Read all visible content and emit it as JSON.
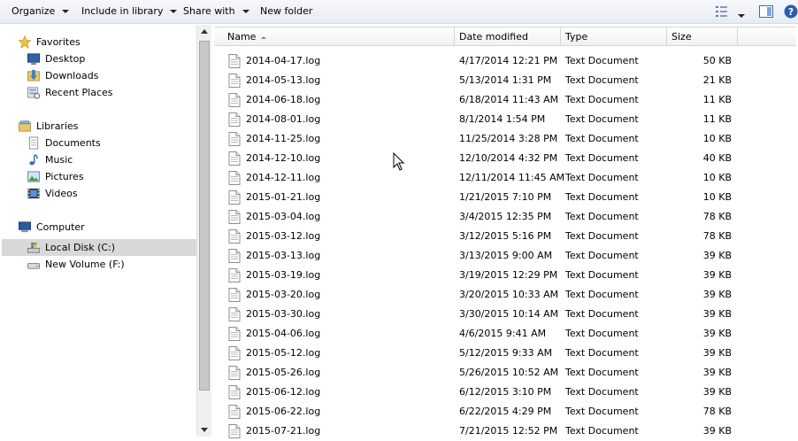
{
  "toolbar": {
    "organize": "Organize",
    "include_in_library": "Include in library",
    "share_with": "Share with",
    "new_folder": "New folder"
  },
  "nav": {
    "favorites": "Favorites",
    "desktop": "Desktop",
    "downloads": "Downloads",
    "recent_places": "Recent Places",
    "libraries": "Libraries",
    "documents": "Documents",
    "music": "Music",
    "pictures": "Pictures",
    "videos": "Videos",
    "computer": "Computer",
    "local_disk": "Local Disk (C:)",
    "new_volume": "New Volume (F:)"
  },
  "columns": {
    "name": "Name",
    "date_modified": "Date modified",
    "type": "Type",
    "size": "Size"
  },
  "files": [
    {
      "name": "2014-04-17.log",
      "date": "4/17/2014 12:21 PM",
      "type": "Text Document",
      "size": "50 KB"
    },
    {
      "name": "2014-05-13.log",
      "date": "5/13/2014 1:31 PM",
      "type": "Text Document",
      "size": "21 KB"
    },
    {
      "name": "2014-06-18.log",
      "date": "6/18/2014 11:43 AM",
      "type": "Text Document",
      "size": "11 KB"
    },
    {
      "name": "2014-08-01.log",
      "date": "8/1/2014 1:54 PM",
      "type": "Text Document",
      "size": "11 KB"
    },
    {
      "name": "2014-11-25.log",
      "date": "11/25/2014 3:28 PM",
      "type": "Text Document",
      "size": "10 KB"
    },
    {
      "name": "2014-12-10.log",
      "date": "12/10/2014 4:32 PM",
      "type": "Text Document",
      "size": "40 KB"
    },
    {
      "name": "2014-12-11.log",
      "date": "12/11/2014 11:45 AM",
      "type": "Text Document",
      "size": "10 KB"
    },
    {
      "name": "2015-01-21.log",
      "date": "1/21/2015 7:10 PM",
      "type": "Text Document",
      "size": "10 KB"
    },
    {
      "name": "2015-03-04.log",
      "date": "3/4/2015 12:35 PM",
      "type": "Text Document",
      "size": "78 KB"
    },
    {
      "name": "2015-03-12.log",
      "date": "3/12/2015 5:16 PM",
      "type": "Text Document",
      "size": "78 KB"
    },
    {
      "name": "2015-03-13.log",
      "date": "3/13/2015 9:00 AM",
      "type": "Text Document",
      "size": "39 KB"
    },
    {
      "name": "2015-03-19.log",
      "date": "3/19/2015 12:29 PM",
      "type": "Text Document",
      "size": "39 KB"
    },
    {
      "name": "2015-03-20.log",
      "date": "3/20/2015 10:33 AM",
      "type": "Text Document",
      "size": "39 KB"
    },
    {
      "name": "2015-03-30.log",
      "date": "3/30/2015 10:14 AM",
      "type": "Text Document",
      "size": "39 KB"
    },
    {
      "name": "2015-04-06.log",
      "date": "4/6/2015 9:41 AM",
      "type": "Text Document",
      "size": "39 KB"
    },
    {
      "name": "2015-05-12.log",
      "date": "5/12/2015 9:33 AM",
      "type": "Text Document",
      "size": "39 KB"
    },
    {
      "name": "2015-05-26.log",
      "date": "5/26/2015 10:52 AM",
      "type": "Text Document",
      "size": "39 KB"
    },
    {
      "name": "2015-06-12.log",
      "date": "6/12/2015 3:10 PM",
      "type": "Text Document",
      "size": "39 KB"
    },
    {
      "name": "2015-06-22.log",
      "date": "6/22/2015 4:29 PM",
      "type": "Text Document",
      "size": "78 KB"
    },
    {
      "name": "2015-07-21.log",
      "date": "7/21/2015 12:52 PM",
      "type": "Text Document",
      "size": "39 KB"
    }
  ]
}
